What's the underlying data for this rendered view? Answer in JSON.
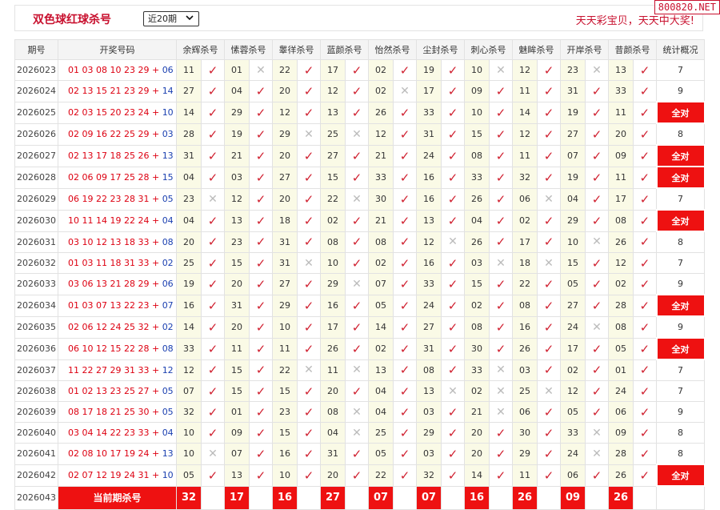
{
  "header": {
    "title": "双色球红球杀号",
    "period_select": "近20期",
    "slogan": "天天彩宝贝，天天中大奖!",
    "watermark": "800820.NET"
  },
  "table": {
    "columns": [
      "期号",
      "开奖号码",
      "余辉杀号",
      "愫蓉杀号",
      "睾徉杀号",
      "蓝颜杀号",
      "怡然杀号",
      "尘封杀号",
      "刺心杀号",
      "魅眸杀号",
      "开岸杀号",
      "昔颜杀号",
      "统计概况"
    ],
    "rows": [
      {
        "issue": "2026023",
        "red": "01 03 08 10 23 29",
        "blue": "06",
        "kills": [
          {
            "n": "11",
            "ok": true
          },
          {
            "n": "01",
            "ok": false
          },
          {
            "n": "22",
            "ok": true
          },
          {
            "n": "17",
            "ok": true
          },
          {
            "n": "02",
            "ok": true
          },
          {
            "n": "19",
            "ok": true
          },
          {
            "n": "10",
            "ok": false
          },
          {
            "n": "12",
            "ok": true
          },
          {
            "n": "23",
            "ok": false
          },
          {
            "n": "13",
            "ok": true
          }
        ],
        "stat": "7"
      },
      {
        "issue": "2026024",
        "red": "02 13 15 21 23 29",
        "blue": "14",
        "kills": [
          {
            "n": "27",
            "ok": true
          },
          {
            "n": "04",
            "ok": true
          },
          {
            "n": "20",
            "ok": true
          },
          {
            "n": "12",
            "ok": true
          },
          {
            "n": "02",
            "ok": false
          },
          {
            "n": "17",
            "ok": true
          },
          {
            "n": "09",
            "ok": true
          },
          {
            "n": "11",
            "ok": true
          },
          {
            "n": "31",
            "ok": true
          },
          {
            "n": "33",
            "ok": true
          }
        ],
        "stat": "9"
      },
      {
        "issue": "2026025",
        "red": "02 03 15 20 23 24",
        "blue": "10",
        "kills": [
          {
            "n": "14",
            "ok": true
          },
          {
            "n": "29",
            "ok": true
          },
          {
            "n": "12",
            "ok": true
          },
          {
            "n": "13",
            "ok": true
          },
          {
            "n": "26",
            "ok": true
          },
          {
            "n": "33",
            "ok": true
          },
          {
            "n": "10",
            "ok": true
          },
          {
            "n": "14",
            "ok": true
          },
          {
            "n": "19",
            "ok": true
          },
          {
            "n": "11",
            "ok": true
          }
        ],
        "stat": "全对",
        "full": true
      },
      {
        "issue": "2026026",
        "red": "02 09 16 22 25 29",
        "blue": "03",
        "kills": [
          {
            "n": "28",
            "ok": true
          },
          {
            "n": "19",
            "ok": true
          },
          {
            "n": "29",
            "ok": false
          },
          {
            "n": "25",
            "ok": false
          },
          {
            "n": "12",
            "ok": true
          },
          {
            "n": "31",
            "ok": true
          },
          {
            "n": "15",
            "ok": true
          },
          {
            "n": "12",
            "ok": true
          },
          {
            "n": "27",
            "ok": true
          },
          {
            "n": "20",
            "ok": true
          }
        ],
        "stat": "8"
      },
      {
        "issue": "2026027",
        "red": "02 13 17 18 25 26",
        "blue": "13",
        "kills": [
          {
            "n": "31",
            "ok": true
          },
          {
            "n": "21",
            "ok": true
          },
          {
            "n": "20",
            "ok": true
          },
          {
            "n": "27",
            "ok": true
          },
          {
            "n": "21",
            "ok": true
          },
          {
            "n": "24",
            "ok": true
          },
          {
            "n": "08",
            "ok": true
          },
          {
            "n": "11",
            "ok": true
          },
          {
            "n": "07",
            "ok": true
          },
          {
            "n": "09",
            "ok": true
          }
        ],
        "stat": "全对",
        "full": true
      },
      {
        "issue": "2026028",
        "red": "02 06 09 17 25 28",
        "blue": "15",
        "kills": [
          {
            "n": "04",
            "ok": true
          },
          {
            "n": "03",
            "ok": true
          },
          {
            "n": "27",
            "ok": true
          },
          {
            "n": "15",
            "ok": true
          },
          {
            "n": "33",
            "ok": true
          },
          {
            "n": "16",
            "ok": true
          },
          {
            "n": "33",
            "ok": true
          },
          {
            "n": "32",
            "ok": true
          },
          {
            "n": "19",
            "ok": true
          },
          {
            "n": "11",
            "ok": true
          }
        ],
        "stat": "全对",
        "full": true
      },
      {
        "issue": "2026029",
        "red": "06 19 22 23 28 31",
        "blue": "05",
        "kills": [
          {
            "n": "23",
            "ok": false
          },
          {
            "n": "12",
            "ok": true
          },
          {
            "n": "20",
            "ok": true
          },
          {
            "n": "22",
            "ok": false
          },
          {
            "n": "30",
            "ok": true
          },
          {
            "n": "16",
            "ok": true
          },
          {
            "n": "26",
            "ok": true
          },
          {
            "n": "06",
            "ok": false
          },
          {
            "n": "04",
            "ok": true
          },
          {
            "n": "17",
            "ok": true
          }
        ],
        "stat": "7"
      },
      {
        "issue": "2026030",
        "red": "10 11 14 19 22 24",
        "blue": "04",
        "kills": [
          {
            "n": "04",
            "ok": true
          },
          {
            "n": "13",
            "ok": true
          },
          {
            "n": "18",
            "ok": true
          },
          {
            "n": "02",
            "ok": true
          },
          {
            "n": "21",
            "ok": true
          },
          {
            "n": "13",
            "ok": true
          },
          {
            "n": "04",
            "ok": true
          },
          {
            "n": "02",
            "ok": true
          },
          {
            "n": "29",
            "ok": true
          },
          {
            "n": "08",
            "ok": true
          }
        ],
        "stat": "全对",
        "full": true
      },
      {
        "issue": "2026031",
        "red": "03 10 12 13 18 33",
        "blue": "08",
        "kills": [
          {
            "n": "20",
            "ok": true
          },
          {
            "n": "23",
            "ok": true
          },
          {
            "n": "31",
            "ok": true
          },
          {
            "n": "08",
            "ok": true
          },
          {
            "n": "08",
            "ok": true
          },
          {
            "n": "12",
            "ok": false
          },
          {
            "n": "26",
            "ok": true
          },
          {
            "n": "17",
            "ok": true
          },
          {
            "n": "10",
            "ok": false
          },
          {
            "n": "26",
            "ok": true
          }
        ],
        "stat": "8"
      },
      {
        "issue": "2026032",
        "red": "01 03 11 18 31 33",
        "blue": "02",
        "kills": [
          {
            "n": "25",
            "ok": true
          },
          {
            "n": "15",
            "ok": true
          },
          {
            "n": "31",
            "ok": false
          },
          {
            "n": "10",
            "ok": true
          },
          {
            "n": "02",
            "ok": true
          },
          {
            "n": "16",
            "ok": true
          },
          {
            "n": "03",
            "ok": false
          },
          {
            "n": "18",
            "ok": false
          },
          {
            "n": "15",
            "ok": true
          },
          {
            "n": "12",
            "ok": true
          }
        ],
        "stat": "7"
      },
      {
        "issue": "2026033",
        "red": "03 06 13 21 28 29",
        "blue": "06",
        "kills": [
          {
            "n": "19",
            "ok": true
          },
          {
            "n": "20",
            "ok": true
          },
          {
            "n": "27",
            "ok": true
          },
          {
            "n": "29",
            "ok": false
          },
          {
            "n": "07",
            "ok": true
          },
          {
            "n": "33",
            "ok": true
          },
          {
            "n": "15",
            "ok": true
          },
          {
            "n": "22",
            "ok": true
          },
          {
            "n": "05",
            "ok": true
          },
          {
            "n": "02",
            "ok": true
          }
        ],
        "stat": "9"
      },
      {
        "issue": "2026034",
        "red": "01 03 07 13 22 23",
        "blue": "07",
        "kills": [
          {
            "n": "16",
            "ok": true
          },
          {
            "n": "31",
            "ok": true
          },
          {
            "n": "29",
            "ok": true
          },
          {
            "n": "16",
            "ok": true
          },
          {
            "n": "05",
            "ok": true
          },
          {
            "n": "24",
            "ok": true
          },
          {
            "n": "02",
            "ok": true
          },
          {
            "n": "08",
            "ok": true
          },
          {
            "n": "27",
            "ok": true
          },
          {
            "n": "28",
            "ok": true
          }
        ],
        "stat": "全对",
        "full": true
      },
      {
        "issue": "2026035",
        "red": "02 06 12 24 25 32",
        "blue": "02",
        "kills": [
          {
            "n": "14",
            "ok": true
          },
          {
            "n": "20",
            "ok": true
          },
          {
            "n": "10",
            "ok": true
          },
          {
            "n": "17",
            "ok": true
          },
          {
            "n": "14",
            "ok": true
          },
          {
            "n": "27",
            "ok": true
          },
          {
            "n": "08",
            "ok": true
          },
          {
            "n": "16",
            "ok": true
          },
          {
            "n": "24",
            "ok": false
          },
          {
            "n": "08",
            "ok": true
          }
        ],
        "stat": "9"
      },
      {
        "issue": "2026036",
        "red": "06 10 12 15 22 28",
        "blue": "08",
        "kills": [
          {
            "n": "33",
            "ok": true
          },
          {
            "n": "11",
            "ok": true
          },
          {
            "n": "11",
            "ok": true
          },
          {
            "n": "26",
            "ok": true
          },
          {
            "n": "02",
            "ok": true
          },
          {
            "n": "31",
            "ok": true
          },
          {
            "n": "30",
            "ok": true
          },
          {
            "n": "26",
            "ok": true
          },
          {
            "n": "17",
            "ok": true
          },
          {
            "n": "05",
            "ok": true
          }
        ],
        "stat": "全对",
        "full": true
      },
      {
        "issue": "2026037",
        "red": "11 22 27 29 31 33",
        "blue": "12",
        "kills": [
          {
            "n": "12",
            "ok": true
          },
          {
            "n": "15",
            "ok": true
          },
          {
            "n": "22",
            "ok": false
          },
          {
            "n": "11",
            "ok": false
          },
          {
            "n": "13",
            "ok": true
          },
          {
            "n": "08",
            "ok": true
          },
          {
            "n": "33",
            "ok": false
          },
          {
            "n": "03",
            "ok": true
          },
          {
            "n": "02",
            "ok": true
          },
          {
            "n": "01",
            "ok": true
          }
        ],
        "stat": "7"
      },
      {
        "issue": "2026038",
        "red": "01 02 13 23 25 27",
        "blue": "05",
        "kills": [
          {
            "n": "07",
            "ok": true
          },
          {
            "n": "15",
            "ok": true
          },
          {
            "n": "15",
            "ok": true
          },
          {
            "n": "20",
            "ok": true
          },
          {
            "n": "04",
            "ok": true
          },
          {
            "n": "13",
            "ok": false
          },
          {
            "n": "02",
            "ok": false
          },
          {
            "n": "25",
            "ok": false
          },
          {
            "n": "12",
            "ok": true
          },
          {
            "n": "24",
            "ok": true
          }
        ],
        "stat": "7"
      },
      {
        "issue": "2026039",
        "red": "08 17 18 21 25 30",
        "blue": "05",
        "kills": [
          {
            "n": "32",
            "ok": true
          },
          {
            "n": "01",
            "ok": true
          },
          {
            "n": "23",
            "ok": true
          },
          {
            "n": "08",
            "ok": false
          },
          {
            "n": "04",
            "ok": true
          },
          {
            "n": "03",
            "ok": true
          },
          {
            "n": "21",
            "ok": false
          },
          {
            "n": "06",
            "ok": true
          },
          {
            "n": "05",
            "ok": true
          },
          {
            "n": "06",
            "ok": true
          }
        ],
        "stat": "9"
      },
      {
        "issue": "2026040",
        "red": "03 04 14 22 23 33",
        "blue": "04",
        "kills": [
          {
            "n": "10",
            "ok": true
          },
          {
            "n": "09",
            "ok": true
          },
          {
            "n": "15",
            "ok": true
          },
          {
            "n": "04",
            "ok": false
          },
          {
            "n": "25",
            "ok": true
          },
          {
            "n": "29",
            "ok": true
          },
          {
            "n": "20",
            "ok": true
          },
          {
            "n": "30",
            "ok": true
          },
          {
            "n": "33",
            "ok": false
          },
          {
            "n": "09",
            "ok": true
          }
        ],
        "stat": "8"
      },
      {
        "issue": "2026041",
        "red": "02 08 10 17 19 24",
        "blue": "13",
        "kills": [
          {
            "n": "10",
            "ok": false
          },
          {
            "n": "07",
            "ok": true
          },
          {
            "n": "16",
            "ok": true
          },
          {
            "n": "31",
            "ok": true
          },
          {
            "n": "05",
            "ok": true
          },
          {
            "n": "03",
            "ok": true
          },
          {
            "n": "20",
            "ok": true
          },
          {
            "n": "29",
            "ok": true
          },
          {
            "n": "24",
            "ok": false
          },
          {
            "n": "28",
            "ok": true
          }
        ],
        "stat": "8"
      },
      {
        "issue": "2026042",
        "red": "02 07 12 19 24 31",
        "blue": "10",
        "kills": [
          {
            "n": "05",
            "ok": true
          },
          {
            "n": "13",
            "ok": true
          },
          {
            "n": "10",
            "ok": true
          },
          {
            "n": "20",
            "ok": true
          },
          {
            "n": "22",
            "ok": true
          },
          {
            "n": "32",
            "ok": true
          },
          {
            "n": "14",
            "ok": true
          },
          {
            "n": "11",
            "ok": true
          },
          {
            "n": "06",
            "ok": true
          },
          {
            "n": "26",
            "ok": true
          }
        ],
        "stat": "全对",
        "full": true
      }
    ],
    "current": {
      "issue": "2026043",
      "label": "当前期杀号",
      "kills": [
        "32",
        "17",
        "16",
        "27",
        "07",
        "07",
        "16",
        "26",
        "09",
        "26"
      ]
    }
  },
  "icons": {
    "ok": "✓",
    "no": "✕"
  },
  "colors": {
    "accent": "#c8102e",
    "highlight": "#ee1111",
    "blue_ball": "#1a3fb0",
    "cell_bg": "#fafae6"
  }
}
